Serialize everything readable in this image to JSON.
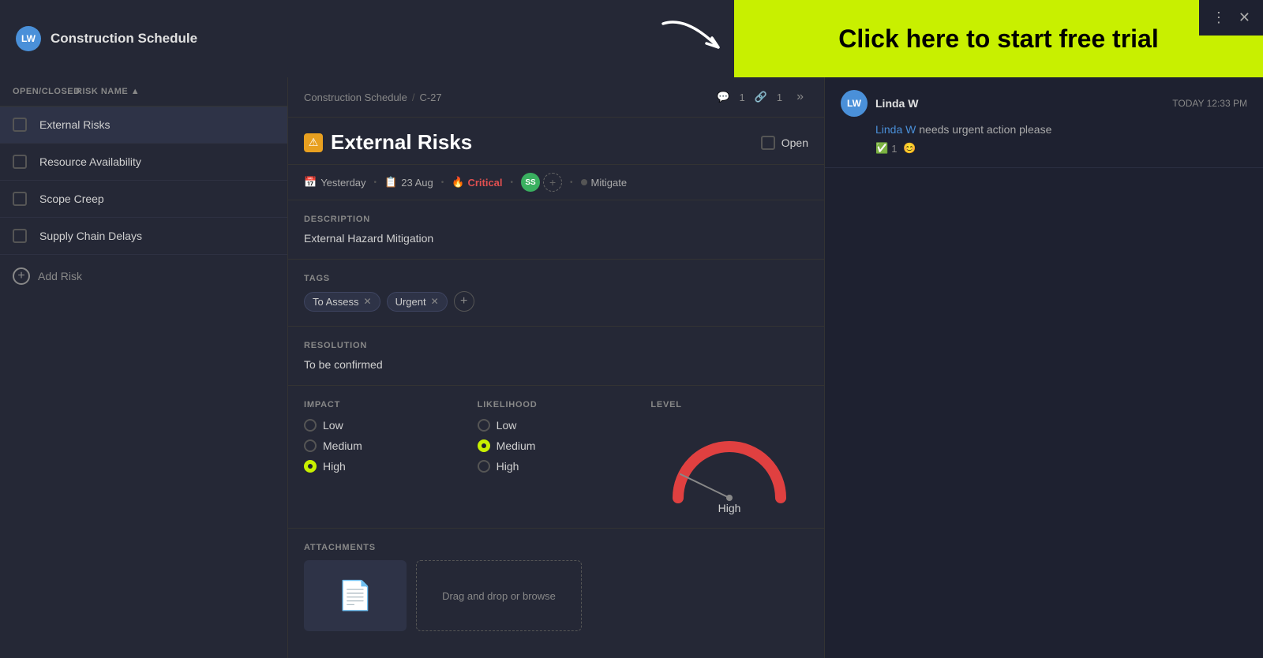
{
  "app": {
    "title": "Construction Schedule",
    "avatar_initials": "LW"
  },
  "top_banner": {
    "cta_text": "Click here to start free trial",
    "cta_bg": "#c8f000",
    "actions": {
      "more_icon": "⋮",
      "close_icon": "✕"
    }
  },
  "sidebar": {
    "col_open": "OPEN/CLOSED",
    "col_name": "RISK NAME ▲",
    "items": [
      {
        "id": "external-risks",
        "name": "External Risks",
        "active": true
      },
      {
        "id": "resource-availability",
        "name": "Resource Availability",
        "active": false
      },
      {
        "id": "scope-creep",
        "name": "Scope Creep",
        "active": false
      },
      {
        "id": "supply-chain-delays",
        "name": "Supply Chain Delays",
        "active": false
      }
    ],
    "add_label": "Add Risk"
  },
  "detail": {
    "breadcrumb_project": "Construction Schedule",
    "breadcrumb_sep": "/",
    "breadcrumb_item": "C-27",
    "comment_count": "1",
    "link_count": "1",
    "risk_title": "External Risks",
    "status_label": "Open",
    "meta": {
      "date_relative": "Yesterday",
      "date_abs": "23 Aug",
      "priority": "Critical",
      "assignee_initials": [
        "SS"
      ],
      "strategy": "Mitigate"
    },
    "description_label": "DESCRIPTION",
    "description_text": "External Hazard Mitigation",
    "tags_label": "TAGS",
    "tags": [
      "To Assess",
      "Urgent"
    ],
    "resolution_label": "RESOLUTION",
    "resolution_text": "To be confirmed",
    "impact_label": "IMPACT",
    "impact_options": [
      "Low",
      "Medium",
      "High"
    ],
    "impact_selected": "High",
    "likelihood_label": "LIKELIHOOD",
    "likelihood_options": [
      "Low",
      "Medium",
      "High"
    ],
    "likelihood_selected": "Medium",
    "level_label": "LEVEL",
    "level_value": "High",
    "attachments_label": "ATTACHMENTS",
    "drop_label": "Drag and drop or browse"
  },
  "chat": {
    "user_name": "Linda W",
    "time": "TODAY 12:33 PM",
    "mention_user": "Linda W",
    "message_text": " needs urgent action please",
    "reaction_emoji": "✅",
    "reaction_count": "1",
    "emoji_icon": "😊"
  }
}
